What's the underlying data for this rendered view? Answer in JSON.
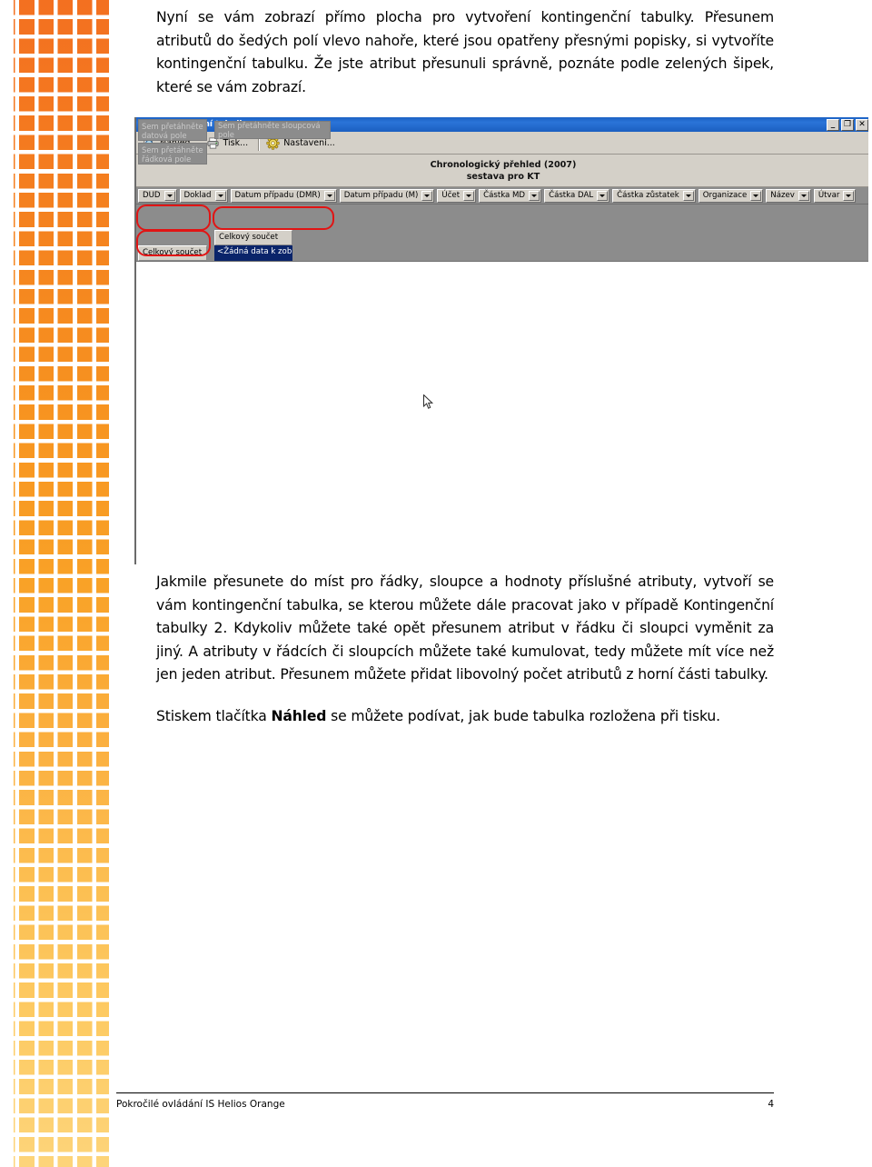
{
  "document": {
    "paragraphs": {
      "intro": "Nyní se vám zobrazí přímo plocha pro vytvoření kontingenční tabulky. Přesunem atributů do šedých polí vlevo nahoře, které jsou opatřeny přesnými popisky, si vytvoříte kontingenční tabulku. Že jste atribut přesunuli správně, poznáte podle zelených šipek, které se vám zobrazí.",
      "body": "Jakmile přesunete do míst pro řádky, sloupce a hodnoty příslušné atributy, vytvoří se vám kontingenční tabulka, se kterou můžete dále pracovat jako v případě Kontingenční tabulky 2. Kdykoliv můžete také opět přesunem atribut v řádku či sloupci vyměnit za jiný. A atributy v řádcích či sloupcích můžete také kumulovat, tedy můžete mít více než jen jeden atribut. Přesunem můžete přidat libovolný počet atributů z horní části tabulky.",
      "tip_prefix": "Stiskem tlačítka ",
      "tip_bold": "Náhled",
      "tip_suffix": " se můžete podívat, jak bude tabulka rozložena při tisku."
    },
    "footer": {
      "left": "Pokročilé ovládání IS Helios Orange",
      "page_number": "4"
    }
  },
  "screenshot": {
    "window": {
      "title": "Kontingenční tabulka",
      "title_icon": "app-logo-icon",
      "controls": [
        {
          "name": "minimize",
          "glyph": "_"
        },
        {
          "name": "restore",
          "glyph": "❐"
        },
        {
          "name": "close",
          "glyph": "✕"
        }
      ]
    },
    "toolbar": {
      "items": [
        {
          "label": "Náhled...",
          "icon": "preview-magnifier-icon"
        },
        {
          "label": "Tisk...",
          "icon": "printer-icon"
        },
        {
          "label": "Nastavení...",
          "icon": "gear-icon"
        }
      ]
    },
    "report_header": {
      "line1": "Chronologický přehled (2007)",
      "line2": "sestava pro KT"
    },
    "field_buttons": [
      "DUD",
      "Doklad",
      "Datum případu (DMR)",
      "Datum případu (M)",
      "Účet",
      "Částka MD",
      "Částka DAL",
      "Částka zůstatek",
      "Organizace",
      "Název",
      "Útvar"
    ],
    "drop_zones": {
      "data": "Sem přetáhněte datová pole",
      "column": "Sem přetáhněte sloupcová pole",
      "row": "Sem přetáhněte řádková pole"
    },
    "grid": {
      "column_total": "Celkový součet",
      "row_total": "Celkový součet",
      "no_data": "<Žádná data k zobra"
    },
    "colors": {
      "titlebar": "#1c62c4",
      "chrome": "#d4d0c8",
      "drop_surface": "#8c8c8c",
      "annotation_ring": "#e11414",
      "selection": "#0a246a",
      "sidebar_top": "#f37020",
      "sidebar_bottom": "#fdd47a"
    }
  }
}
